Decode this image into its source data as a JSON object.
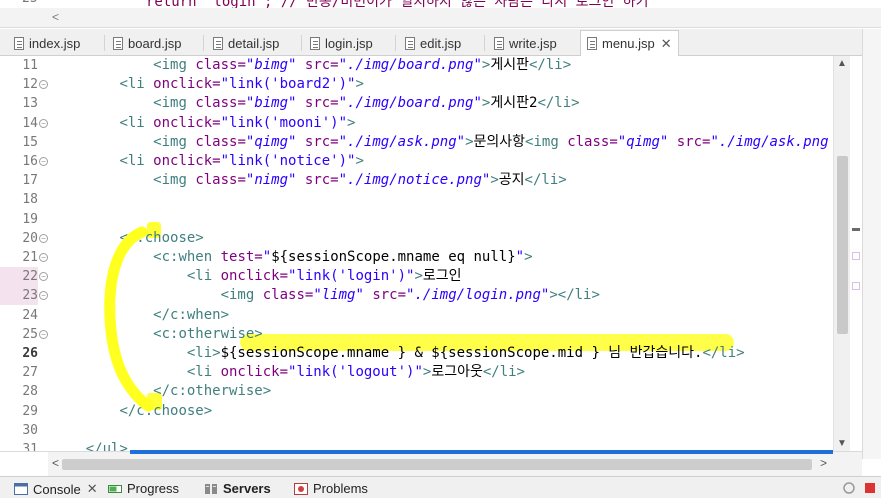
{
  "previous_editor": {
    "line_number": "25",
    "code": "return \"login\"; // 만동/비번이가 일치하지 않은 사람은 다시 로그인 하기"
  },
  "tabs": [
    {
      "label": "index.jsp",
      "active": false
    },
    {
      "label": "board.jsp",
      "active": false
    },
    {
      "label": "detail.jsp",
      "active": false
    },
    {
      "label": "login.jsp",
      "active": false
    },
    {
      "label": "edit.jsp",
      "active": false
    },
    {
      "label": "write.jsp",
      "active": false
    },
    {
      "label": "menu.jsp",
      "active": true
    }
  ],
  "tab_close_glyph": "✕",
  "editor": {
    "lines": [
      {
        "n": "11",
        "fold": false,
        "segments": [
          [
            "",
            "            "
          ],
          [
            "tg",
            "<img "
          ],
          [
            "at",
            "class="
          ],
          [
            "vs",
            "\"bimg\""
          ],
          [
            "at",
            " src="
          ],
          [
            "vs",
            "\"./img/board.png\""
          ],
          [
            "tg",
            ">"
          ],
          [
            "el",
            "게시판"
          ],
          [
            "tg",
            "</li>"
          ]
        ]
      },
      {
        "n": "12",
        "fold": true,
        "segments": [
          [
            "",
            "        "
          ],
          [
            "tg",
            "<li "
          ],
          [
            "at",
            "onclick="
          ],
          [
            "vp",
            "\"link('board2')\""
          ],
          [
            "tg",
            ">"
          ]
        ]
      },
      {
        "n": "13",
        "fold": false,
        "segments": [
          [
            "",
            "            "
          ],
          [
            "tg",
            "<img "
          ],
          [
            "at",
            "class="
          ],
          [
            "vs",
            "\"bimg\""
          ],
          [
            "at",
            " src="
          ],
          [
            "vs",
            "\"./img/board.png\""
          ],
          [
            "tg",
            ">"
          ],
          [
            "el",
            "게시판2"
          ],
          [
            "tg",
            "</li>"
          ]
        ]
      },
      {
        "n": "14",
        "fold": true,
        "segments": [
          [
            "",
            "        "
          ],
          [
            "tg",
            "<li "
          ],
          [
            "at",
            "onclick="
          ],
          [
            "vp",
            "\"link('mooni')\""
          ],
          [
            "tg",
            ">"
          ]
        ]
      },
      {
        "n": "15",
        "fold": false,
        "segments": [
          [
            "",
            "            "
          ],
          [
            "tg",
            "<img "
          ],
          [
            "at",
            "class="
          ],
          [
            "vs",
            "\"qimg\""
          ],
          [
            "at",
            " src="
          ],
          [
            "vs",
            "\"./img/ask.png\""
          ],
          [
            "tg",
            ">"
          ],
          [
            "el",
            "문의사항"
          ],
          [
            "tg",
            "<img "
          ],
          [
            "at",
            "class="
          ],
          [
            "vs",
            "\"qimg\""
          ],
          [
            "at",
            " src="
          ],
          [
            "vs",
            "\"./img/ask.png"
          ]
        ]
      },
      {
        "n": "16",
        "fold": true,
        "segments": [
          [
            "",
            "        "
          ],
          [
            "tg",
            "<li "
          ],
          [
            "at",
            "onclick="
          ],
          [
            "vp",
            "\"link('notice')\""
          ],
          [
            "tg",
            ">"
          ]
        ]
      },
      {
        "n": "17",
        "fold": false,
        "segments": [
          [
            "",
            "            "
          ],
          [
            "tg",
            "<img "
          ],
          [
            "at",
            "class="
          ],
          [
            "vs",
            "\"nimg\""
          ],
          [
            "at",
            " src="
          ],
          [
            "vs",
            "\"./img/notice.png\""
          ],
          [
            "tg",
            ">"
          ],
          [
            "el",
            "공지"
          ],
          [
            "tg",
            "</li>"
          ]
        ]
      },
      {
        "n": "18",
        "fold": false,
        "segments": []
      },
      {
        "n": "19",
        "fold": false,
        "segments": []
      },
      {
        "n": "20",
        "fold": true,
        "segments": [
          [
            "",
            "        "
          ],
          [
            "tg",
            "<c:choose>"
          ]
        ]
      },
      {
        "n": "21",
        "fold": true,
        "segments": [
          [
            "",
            "            "
          ],
          [
            "tg",
            "<c:when "
          ],
          [
            "at",
            "test="
          ],
          [
            "vp",
            "\""
          ],
          [
            "el",
            "${sessionScope.mname eq null}"
          ],
          [
            "vp",
            "\""
          ],
          [
            "tg",
            ">"
          ]
        ]
      },
      {
        "n": "22",
        "fold": true,
        "mark": true,
        "segments": [
          [
            "",
            "                "
          ],
          [
            "tg",
            "<li "
          ],
          [
            "at",
            "onclick="
          ],
          [
            "vp",
            "\"link('login')\""
          ],
          [
            "tg",
            ">"
          ],
          [
            "el",
            "로그인"
          ]
        ]
      },
      {
        "n": "23",
        "fold": true,
        "mark": true,
        "segments": [
          [
            "",
            "                    "
          ],
          [
            "tg",
            "<img "
          ],
          [
            "at",
            "class="
          ],
          [
            "vs",
            "\"limg\""
          ],
          [
            "at",
            " src="
          ],
          [
            "vs",
            "\"./img/login.png\""
          ],
          [
            "tg",
            "></li>"
          ]
        ]
      },
      {
        "n": "24",
        "fold": false,
        "segments": [
          [
            "",
            "            "
          ],
          [
            "tg",
            "</c:when>"
          ]
        ]
      },
      {
        "n": "25",
        "fold": true,
        "segments": [
          [
            "",
            "            "
          ],
          [
            "tg",
            "<c:otherwise>"
          ]
        ]
      },
      {
        "n": "26",
        "fold": false,
        "current": true,
        "segments": [
          [
            "",
            "                "
          ],
          [
            "tg",
            "<li>"
          ],
          [
            "el",
            "${sessionScope.mname } & ${sessionScope.mid } 님 반갑습니다."
          ],
          [
            "tg",
            "</li>"
          ]
        ]
      },
      {
        "n": "27",
        "fold": false,
        "segments": [
          [
            "",
            "                "
          ],
          [
            "tg",
            "<li "
          ],
          [
            "at",
            "onclick="
          ],
          [
            "vp",
            "\"link('logout')\""
          ],
          [
            "tg",
            ">"
          ],
          [
            "el",
            "로그아웃"
          ],
          [
            "tg",
            "</li>"
          ]
        ]
      },
      {
        "n": "28",
        "fold": false,
        "segments": [
          [
            "",
            "            "
          ],
          [
            "tg",
            "</c:otherwise>"
          ]
        ]
      },
      {
        "n": "29",
        "fold": false,
        "segments": [
          [
            "",
            "        "
          ],
          [
            "tg",
            "</c:choose>"
          ]
        ]
      },
      {
        "n": "30",
        "fold": false,
        "segments": []
      },
      {
        "n": "31",
        "fold": false,
        "segments": [
          [
            "",
            "    "
          ],
          [
            "tg",
            "</ul>"
          ]
        ]
      }
    ],
    "fold_glyph": "−",
    "colors": {
      "highlighter": "#ffff35",
      "accent_blue": "#1e6fd9"
    }
  },
  "scroll": {
    "up": "▲",
    "down": "▼",
    "left": "<",
    "right": ">"
  },
  "bottom_tabs": [
    {
      "label": "Console",
      "close": "✕",
      "bold": false
    },
    {
      "label": "Progress",
      "close": "",
      "bold": false
    },
    {
      "label": "Servers",
      "close": "",
      "bold": true
    },
    {
      "label": "Problems",
      "close": "",
      "bold": false
    }
  ]
}
